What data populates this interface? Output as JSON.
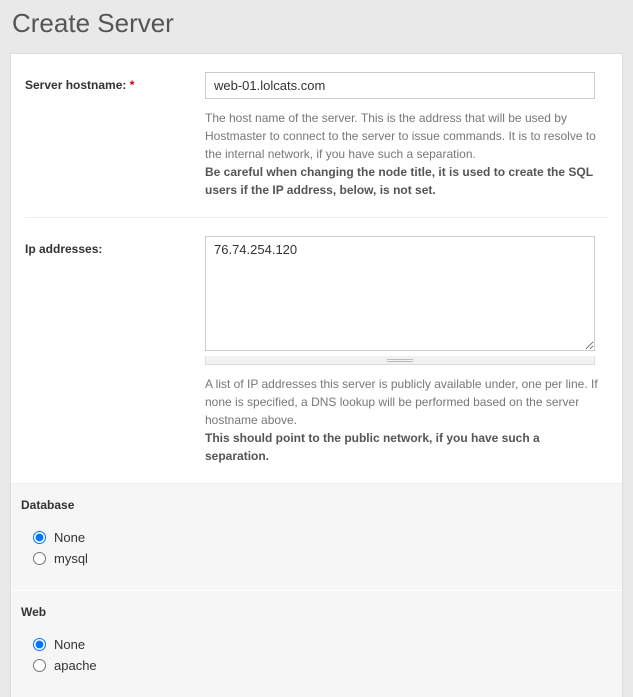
{
  "page": {
    "title": "Create Server"
  },
  "hostname": {
    "label": "Server hostname:",
    "required_mark": "*",
    "value": "web-01.lolcats.com",
    "help": "The host name of the server. This is the address that will be used by Hostmaster to connect to the server to issue commands. It is to resolve to the internal network, if you have such a separation.",
    "help_bold": "Be careful when changing the node title, it is used to create the SQL users if the IP address, below, is not set."
  },
  "ip": {
    "label": "Ip addresses:",
    "value": "76.74.254.120",
    "help": "A list of IP addresses this server is publicly available under, one per line. If none is specified, a DNS lookup will be performed based on the server hostname above.",
    "help_bold": "This should point to the public network, if you have such a separation."
  },
  "database": {
    "legend": "Database",
    "options": {
      "none": "None",
      "mysql": "mysql"
    }
  },
  "web": {
    "legend": "Web",
    "options": {
      "none": "None",
      "apache": "apache"
    }
  }
}
